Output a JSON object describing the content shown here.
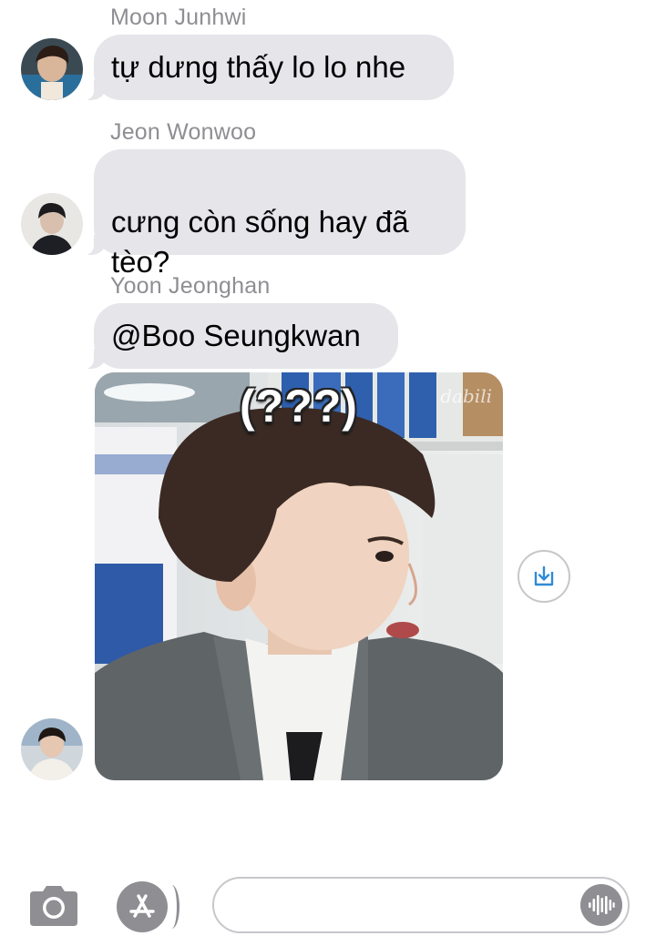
{
  "messages": [
    {
      "sender": "Moon Junhwi",
      "text": "tự dưng thấy lo lo nhe"
    },
    {
      "sender": "Jeon Wonwoo",
      "text": "cưng còn sống hay đã\ntèo?"
    },
    {
      "sender": "Yoon Jeonghan",
      "text": "@Boo Seungkwan"
    }
  ],
  "image_message": {
    "caption": "(???)",
    "watermark": "dabili"
  },
  "composer": {
    "placeholder": ""
  },
  "icons": {
    "camera": "camera-icon",
    "apps": "app-store-icon",
    "audio": "audio-waveform-icon",
    "save": "download-icon"
  },
  "colors": {
    "incoming_bubble": "#e5e5ea",
    "sender_label": "#8e8e93",
    "accent": "#2f8bd6"
  }
}
